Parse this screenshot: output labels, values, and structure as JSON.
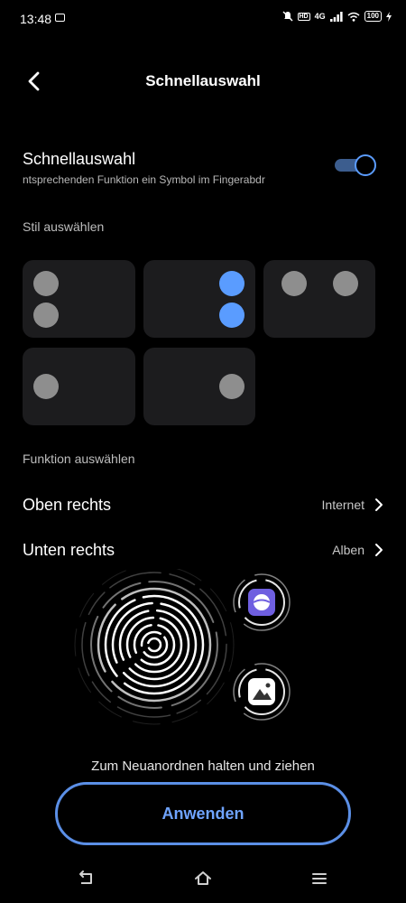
{
  "status_bar": {
    "time": "13:48",
    "network": "4G",
    "battery": "100"
  },
  "header": {
    "title": "Schnellauswahl"
  },
  "toggle_row": {
    "title": "Schnellauswahl",
    "subtitle": "ntsprechenden Funktion ein Symbol im Fingerabdr",
    "enabled": true
  },
  "style_section": {
    "label": "Stil auswählen",
    "options": [
      {
        "selected": false
      },
      {
        "selected": true
      },
      {
        "selected": false
      },
      {
        "selected": false
      },
      {
        "selected": false
      }
    ]
  },
  "function_section": {
    "label": "Funktion auswählen",
    "rows": [
      {
        "label": "Oben rechts",
        "value": "Internet"
      },
      {
        "label": "Unten rechts",
        "value": "Alben"
      }
    ]
  },
  "preview": {
    "icons": [
      "internet-app-icon",
      "gallery-app-icon"
    ]
  },
  "hint": "Zum Neuanordnen halten und ziehen",
  "apply_button": {
    "label": "Anwenden"
  },
  "colors": {
    "accent": "#5a9cff",
    "card": "#1c1c1e",
    "dot": "#8e8e8e",
    "background": "#000000"
  }
}
